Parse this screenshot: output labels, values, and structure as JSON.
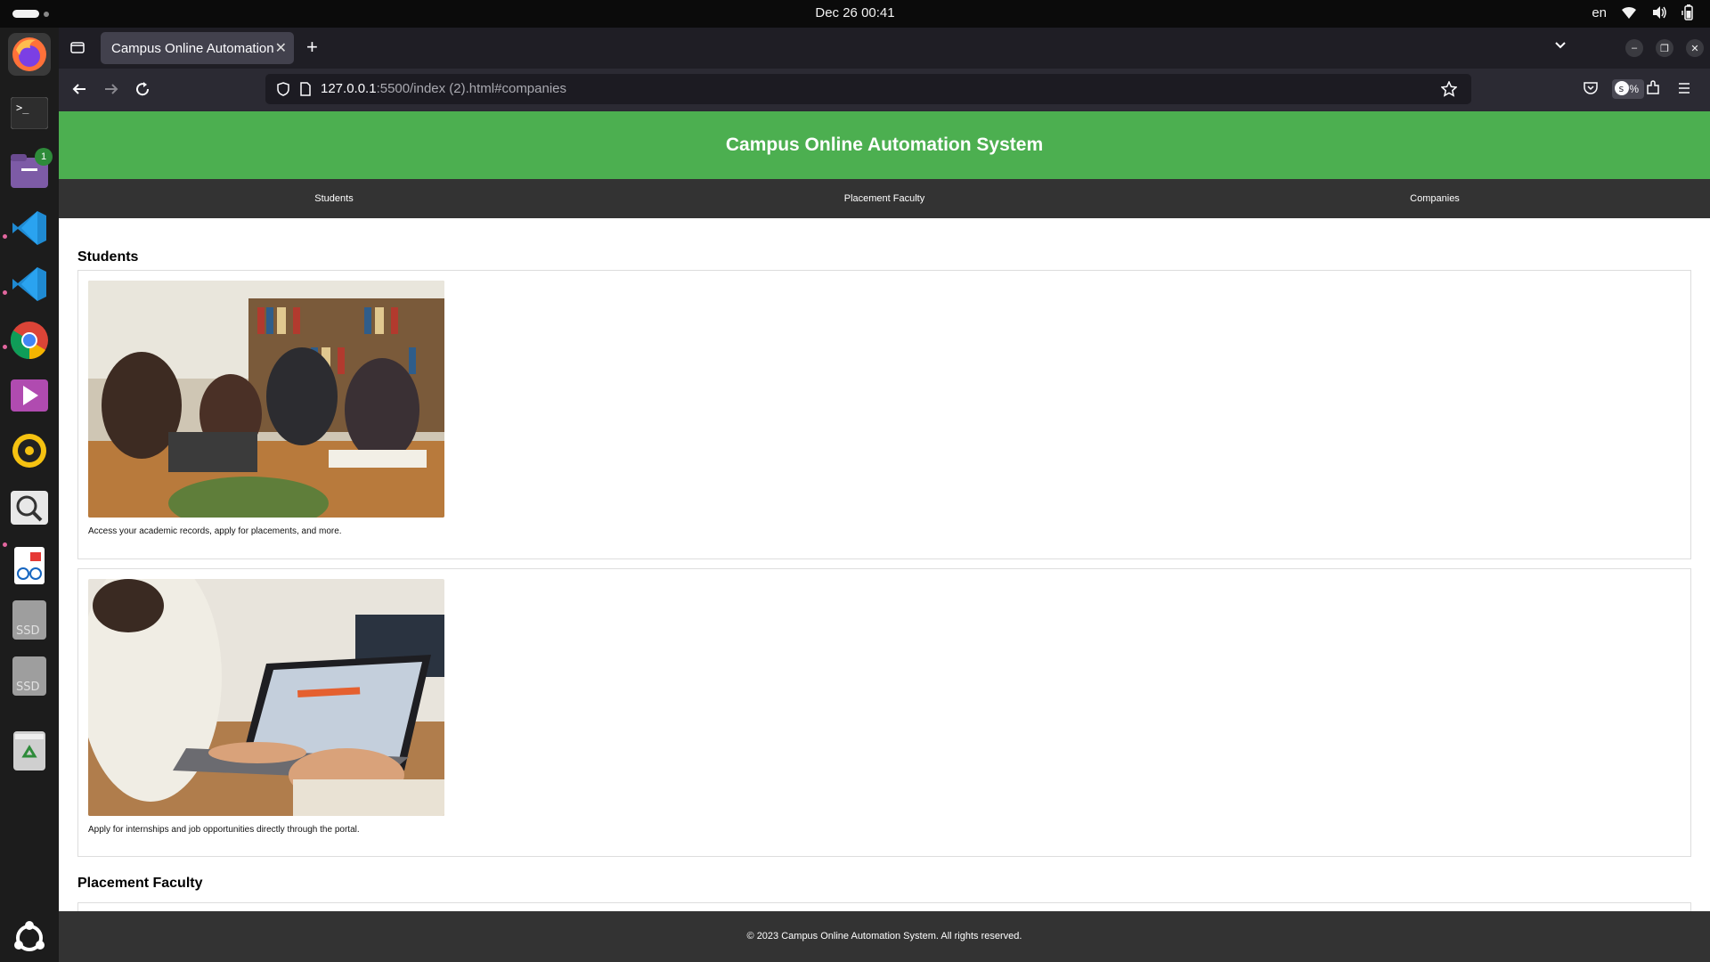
{
  "system": {
    "clock": "Dec 26  00:41",
    "language": "en"
  },
  "dock": {
    "notification_count": "1",
    "ssd_label_1": "SSD",
    "ssd_label_2": "SSD"
  },
  "browser": {
    "tab_title": "Campus Online Automation",
    "url_host": "127.0.0.1",
    "url_rest": ":5500/index (2).html#companies",
    "zoom": "67%"
  },
  "site": {
    "header_title": "Campus Online Automation System",
    "nav": [
      "Students",
      "Placement Faculty",
      "Companies"
    ],
    "sections": [
      {
        "title": "Students",
        "cards": [
          {
            "image_icon": "students-library-photo",
            "text": "Access your academic records, apply for placements, and more."
          },
          {
            "image_icon": "laptop-application-photo",
            "text": "Apply for internships and job opportunities directly through the portal."
          }
        ]
      },
      {
        "title": "Placement Faculty"
      }
    ],
    "footer": "© 2023 Campus Online Automation System. All rights reserved."
  },
  "colors": {
    "header_green": "#4caf50",
    "nav_dark": "#333333"
  }
}
